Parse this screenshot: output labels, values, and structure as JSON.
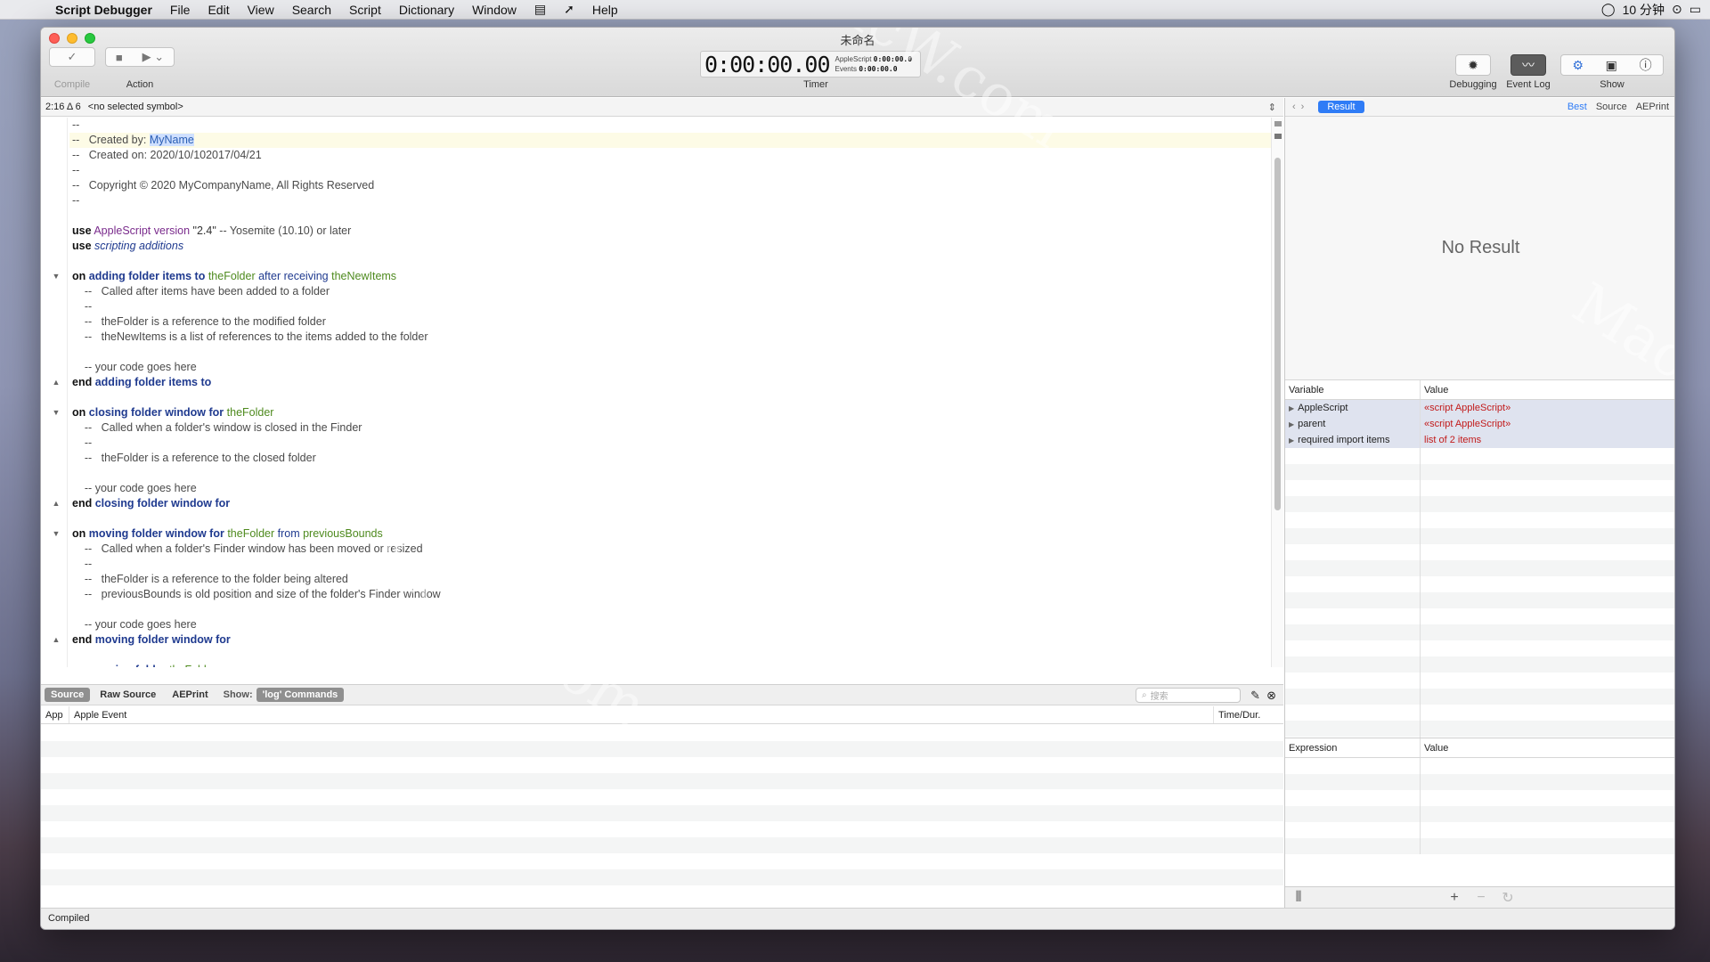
{
  "menubar": {
    "app_name": "Script Debugger",
    "items": [
      "File",
      "Edit",
      "View",
      "Search",
      "Script",
      "Dictionary",
      "Window",
      "Help"
    ],
    "clock": "10 分钟"
  },
  "window": {
    "title": "未命名",
    "toolbar": {
      "compile_label": "Compile",
      "action_label": "Action",
      "timer_label": "Timer",
      "timer_value": "0:00:00.00",
      "timer_applescript_label": "AppleScript",
      "timer_applescript_value": "0:00:00.0",
      "timer_events_label": "Events",
      "timer_events_value": "0:00:00.0",
      "debugging_label": "Debugging",
      "event_log_label": "Event Log",
      "show_label": "Show"
    },
    "editor": {
      "position": "2:16 Δ 6",
      "symbol": "<no selected symbol>",
      "lines": [
        {
          "t": "--"
        },
        {
          "t": "--   Created by: MyName"
        },
        {
          "t": "--   Created on: 2020/10/102017/04/21"
        },
        {
          "t": "--"
        },
        {
          "t": "--   Copyright © 2020 MyCompanyName, All Rights Reserved"
        },
        {
          "t": "--"
        },
        {
          "t": ""
        },
        {
          "t": "use AppleScript version \"2.4\" -- Yosemite (10.10) or later"
        },
        {
          "t": "use scripting additions"
        },
        {
          "t": ""
        },
        {
          "t": "on adding folder items to theFolder after receiving theNewItems"
        },
        {
          "t": "    --   Called after items have been added to a folder"
        },
        {
          "t": "    --"
        },
        {
          "t": "    --   theFolder is a reference to the modified folder"
        },
        {
          "t": "    --   theNewItems is a list of references to the items added to the folder"
        },
        {
          "t": ""
        },
        {
          "t": "    -- your code goes here"
        },
        {
          "t": "end adding folder items to"
        },
        {
          "t": ""
        },
        {
          "t": "on closing folder window for theFolder"
        },
        {
          "t": "    --   Called when a folder's window is closed in the Finder"
        },
        {
          "t": "    --"
        },
        {
          "t": "    --   theFolder is a reference to the closed folder"
        },
        {
          "t": ""
        },
        {
          "t": "    -- your code goes here"
        },
        {
          "t": "end closing folder window for"
        },
        {
          "t": ""
        },
        {
          "t": "on moving folder window for theFolder from previousBounds"
        },
        {
          "t": "    --   Called when a folder's Finder window has been moved or resized"
        },
        {
          "t": "    --"
        },
        {
          "t": "    --   theFolder is a reference to the folder being altered"
        },
        {
          "t": "    --   previousBounds is old position and size of the folder's Finder window"
        },
        {
          "t": ""
        },
        {
          "t": "    -- your code goes here"
        },
        {
          "t": "end moving folder window for"
        },
        {
          "t": ""
        },
        {
          "t": "on opening folder theFolder"
        }
      ]
    },
    "log": {
      "tabs": [
        "Source",
        "Raw Source",
        "AEPrint"
      ],
      "show_label": "Show:",
      "show_value": "'log' Commands",
      "search_placeholder": "搜索",
      "columns": [
        "App",
        "Apple Event",
        "Time/Dur."
      ]
    },
    "status": "Compiled",
    "result_panel": {
      "result_button": "Result",
      "tabs": [
        "Best",
        "Source",
        "AEPrint"
      ],
      "no_result": "No Result",
      "variables_header": [
        "Variable",
        "Value"
      ],
      "variables": [
        {
          "name": "AppleScript",
          "value": "«script AppleScript»"
        },
        {
          "name": "parent",
          "value": "«script AppleScript»"
        },
        {
          "name": "required import items",
          "value": "list of 2 items"
        }
      ],
      "expressions_header": [
        "Expression",
        "Value"
      ]
    }
  },
  "watermark": "MacW.com"
}
